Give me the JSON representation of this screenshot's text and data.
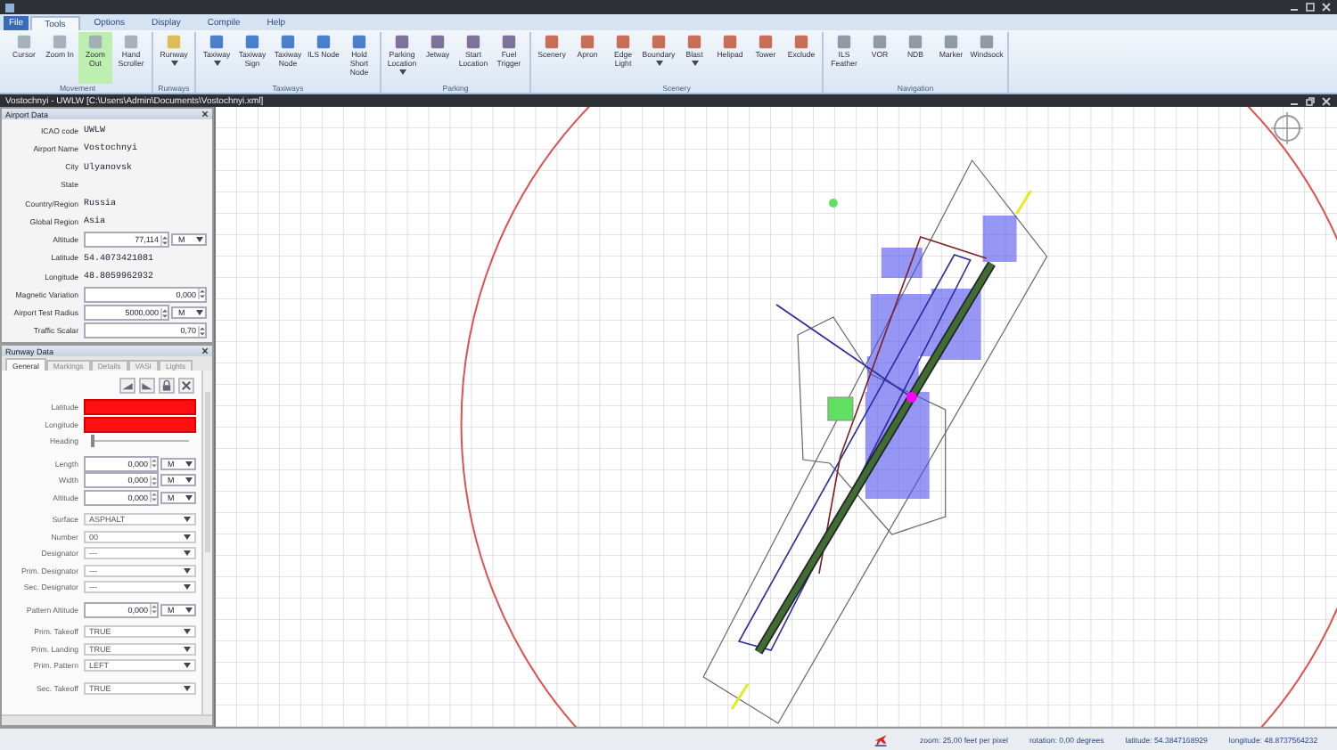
{
  "menu_tabs": [
    {
      "label": "File",
      "selected": false
    },
    {
      "label": "Tools",
      "selected": true
    },
    {
      "label": "Options",
      "selected": false
    },
    {
      "label": "Display",
      "selected": false
    },
    {
      "label": "Compile",
      "selected": false
    },
    {
      "label": "Help",
      "selected": false
    }
  ],
  "ribbon": [
    {
      "label": "Movement",
      "buttons": [
        {
          "label": "Cursor",
          "dropdown": false,
          "selected": false
        },
        {
          "label": "Zoom In",
          "dropdown": false,
          "selected": false
        },
        {
          "label": "Zoom Out",
          "dropdown": false,
          "selected": true
        },
        {
          "label": "Hand Scroller",
          "dropdown": false,
          "selected": false
        }
      ]
    },
    {
      "label": "Runways",
      "buttons": [
        {
          "label": "Runway",
          "dropdown": true,
          "selected": false
        }
      ]
    },
    {
      "label": "Taxiways",
      "buttons": [
        {
          "label": "Taxiway",
          "dropdown": true,
          "selected": false
        },
        {
          "label": "Taxiway Sign",
          "dropdown": false,
          "selected": false
        },
        {
          "label": "Taxiway Node",
          "dropdown": false,
          "selected": false
        },
        {
          "label": "ILS Node",
          "dropdown": false,
          "selected": false
        },
        {
          "label": "Hold Short Node",
          "dropdown": false,
          "selected": false
        }
      ]
    },
    {
      "label": "Parking",
      "buttons": [
        {
          "label": "Parking Location",
          "dropdown": true,
          "selected": false
        },
        {
          "label": "Jetway",
          "dropdown": false,
          "selected": false
        },
        {
          "label": "Start Location",
          "dropdown": false,
          "selected": false
        },
        {
          "label": "Fuel Trigger",
          "dropdown": false,
          "selected": false
        }
      ]
    },
    {
      "label": "Scenery",
      "buttons": [
        {
          "label": "Scenery",
          "dropdown": false,
          "selected": false
        },
        {
          "label": "Apron",
          "dropdown": false,
          "selected": false
        },
        {
          "label": "Edge Light",
          "dropdown": false,
          "selected": false
        },
        {
          "label": "Boundary",
          "dropdown": true,
          "selected": false
        },
        {
          "label": "Blast",
          "dropdown": true,
          "selected": false
        },
        {
          "label": "Helipad",
          "dropdown": false,
          "selected": false
        },
        {
          "label": "Tower",
          "dropdown": false,
          "selected": false
        },
        {
          "label": "Exclude",
          "dropdown": false,
          "selected": false
        }
      ]
    },
    {
      "label": "Navigation",
      "buttons": [
        {
          "label": "ILS Feather",
          "dropdown": false,
          "selected": false
        },
        {
          "label": "VOR",
          "dropdown": false,
          "selected": false
        },
        {
          "label": "NDB",
          "dropdown": false,
          "selected": false
        },
        {
          "label": "Marker",
          "dropdown": false,
          "selected": false
        },
        {
          "label": "Windsock",
          "dropdown": false,
          "selected": false
        }
      ]
    }
  ],
  "document": {
    "title": "Vostochnyi - UWLW [C:\\Users\\Admin\\Documents\\Vostochnyi.xml]"
  },
  "airport_data": {
    "title": "Airport Data",
    "fields": [
      {
        "label": "ICAO code",
        "kind": "text",
        "value": "UWLW"
      },
      {
        "label": "Airport Name",
        "kind": "text",
        "value": "Vostochnyi"
      },
      {
        "label": "City",
        "kind": "text",
        "value": "Ulyanovsk"
      },
      {
        "label": "State",
        "kind": "text"
      },
      {
        "label": "Country/Region",
        "kind": "text",
        "value": "Russia"
      },
      {
        "label": "Global Region",
        "kind": "text",
        "value": "Asia"
      },
      {
        "label": "Altitude",
        "kind": "spin",
        "value": "77,114",
        "unit": "M"
      },
      {
        "label": "Latitude",
        "kind": "text",
        "value": "54.4073421081"
      },
      {
        "label": "Longitude",
        "kind": "text",
        "value": "48.8059962932"
      },
      {
        "label": "Magnetic Variation",
        "kind": "spin",
        "value": "0,000"
      },
      {
        "label": "Airport Test Radius",
        "kind": "spin",
        "value": "5000,000",
        "unit": "M"
      },
      {
        "label": "Traffic Scalar",
        "kind": "spin",
        "value": "0,70"
      }
    ]
  },
  "runway_data": {
    "title": "Runway Data",
    "tabs": [
      {
        "label": "General",
        "selected": true
      },
      {
        "label": "Markings",
        "selected": false
      },
      {
        "label": "Details",
        "selected": false
      },
      {
        "label": "VASI",
        "selected": false
      },
      {
        "label": "Lights",
        "selected": false
      }
    ],
    "sections": [
      [
        {
          "label": "Latitude",
          "kind": "text",
          "invalid": true
        },
        {
          "label": "Longitude",
          "kind": "text",
          "invalid": true
        },
        {
          "label": "Heading",
          "kind": "slider",
          "level": 0
        }
      ],
      [
        {
          "label": "Length",
          "kind": "spin",
          "value": "0,000",
          "unit": "M"
        },
        {
          "label": "Width",
          "kind": "spin",
          "value": "0,000",
          "unit": "M"
        },
        {
          "label": "Altitude",
          "kind": "spin",
          "value": "0,000",
          "unit": "M"
        }
      ],
      [
        {
          "label": "Surface",
          "kind": "select",
          "value": "ASPHALT"
        },
        {
          "label": "Number",
          "kind": "select",
          "value": "00"
        },
        {
          "label": "Designator",
          "kind": "select",
          "value": "---"
        },
        {
          "label": "Prim. Designator",
          "kind": "select",
          "value": "---"
        },
        {
          "label": "Sec. Designator",
          "kind": "select",
          "value": "---"
        }
      ],
      [
        {
          "label": "Pattern Altitude",
          "kind": "spin",
          "value": "0,000",
          "unit": "M"
        }
      ],
      [
        {
          "label": "Prim. Takeoff",
          "kind": "select",
          "value": "TRUE"
        },
        {
          "label": "Prim. Landing",
          "kind": "select",
          "value": "TRUE"
        },
        {
          "label": "Prim. Pattern",
          "kind": "select",
          "value": "LEFT"
        }
      ],
      [
        {
          "label": "Sec. Takeoff",
          "kind": "select",
          "value": "TRUE"
        }
      ]
    ]
  },
  "status_bar": {
    "zoom": "zoom: 25,00 feet per pixel",
    "rotation": "rotation: 0,00 degrees",
    "latitude": "latitude: 54.3847168929",
    "longitude": "longitude: 48.8737564232"
  }
}
